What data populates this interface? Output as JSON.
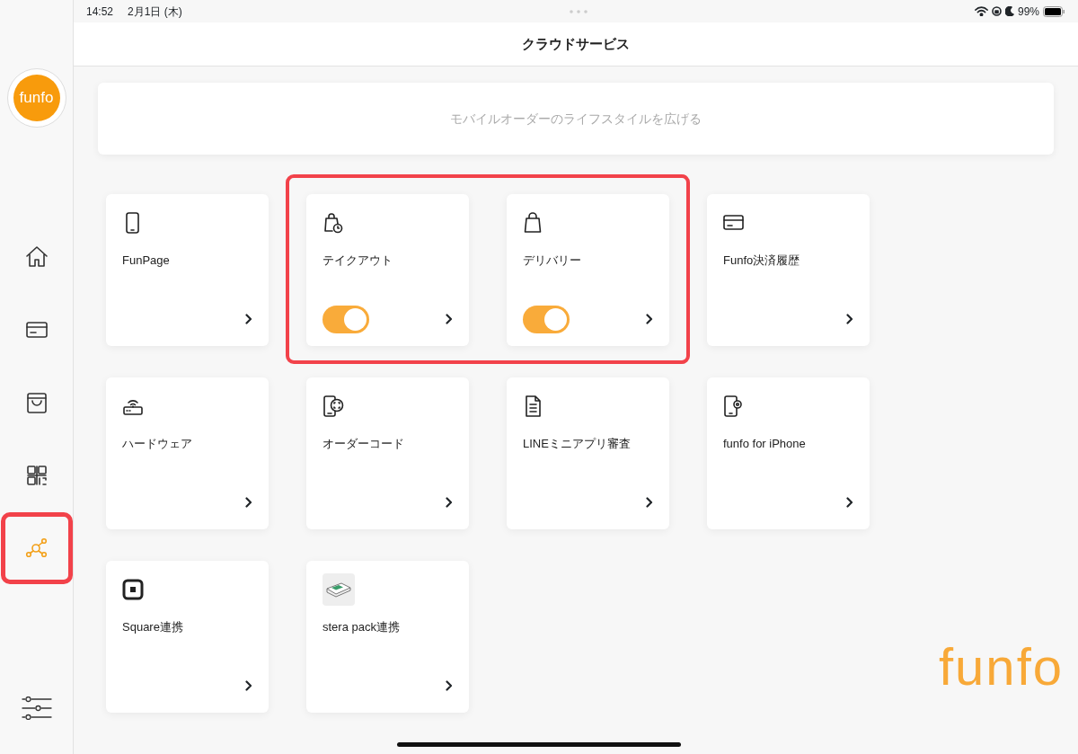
{
  "status_bar": {
    "time": "14:52",
    "date": "2月1日 (木)",
    "battery": "99%"
  },
  "header": {
    "title": "クラウドサービス"
  },
  "sidebar": {
    "logo": "funfo",
    "items": [
      {
        "selected": false,
        "highlighted": false
      },
      {
        "selected": false,
        "highlighted": false
      },
      {
        "selected": false,
        "highlighted": false
      },
      {
        "selected": false,
        "highlighted": false
      },
      {
        "selected": true,
        "highlighted": true
      }
    ]
  },
  "banner": {
    "text": "モバイルオーダーのライフスタイルを広げる"
  },
  "cards": [
    {
      "title": "FunPage",
      "highlighted": false
    },
    {
      "title": "テイクアウト",
      "switch_on": true,
      "highlighted": true
    },
    {
      "title": "デリバリー",
      "switch_on": true,
      "highlighted": true
    },
    {
      "title": "Funfo決済履歴",
      "highlighted": false
    },
    {
      "title": "ハードウェア",
      "highlighted": false
    },
    {
      "title": "オーダーコード",
      "highlighted": false
    },
    {
      "title": "LINEミニアプリ審査",
      "highlighted": false
    },
    {
      "title": "funfo for iPhone",
      "highlighted": false
    },
    {
      "title": "Square連携",
      "highlighted": false
    },
    {
      "title": "stera pack連携",
      "highlighted": false
    }
  ],
  "brand_logo": "funfo"
}
